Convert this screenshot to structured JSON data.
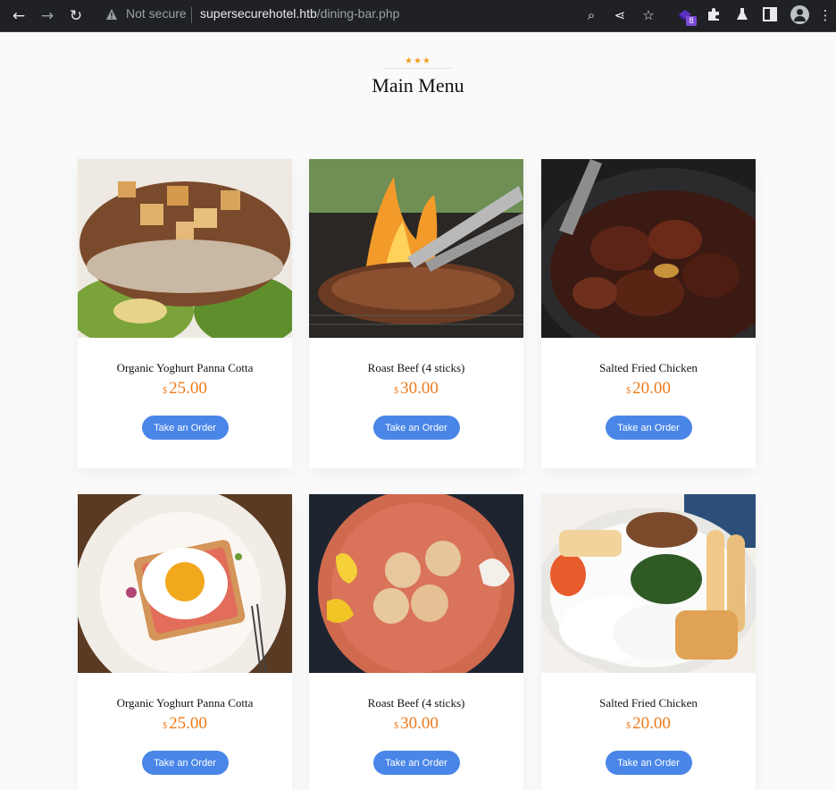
{
  "browser": {
    "security_label": "Not secure",
    "url_host": "supersecurehotel.htb",
    "url_path": "/dining-bar.php",
    "extension_badge": "8"
  },
  "menu": {
    "stars": "★★★",
    "title": "Main Menu",
    "currency": "$",
    "button_label": "Take an Order",
    "items": [
      {
        "name": "Organic Yoghurt Panna Cotta",
        "price": "25.00",
        "image": "grilled-pork-chop"
      },
      {
        "name": "Roast Beef (4 sticks)",
        "price": "30.00",
        "image": "grilled-steak-flames"
      },
      {
        "name": "Salted Fried Chicken",
        "price": "20.00",
        "image": "braised-meat-skillet"
      },
      {
        "name": "Organic Yoghurt Panna Cotta",
        "price": "25.00",
        "image": "fried-egg-toast"
      },
      {
        "name": "Roast Beef (4 sticks)",
        "price": "30.00",
        "image": "cookies-on-plate"
      },
      {
        "name": "Salted Fried Chicken",
        "price": "20.00",
        "image": "breakfast-plate"
      }
    ]
  }
}
